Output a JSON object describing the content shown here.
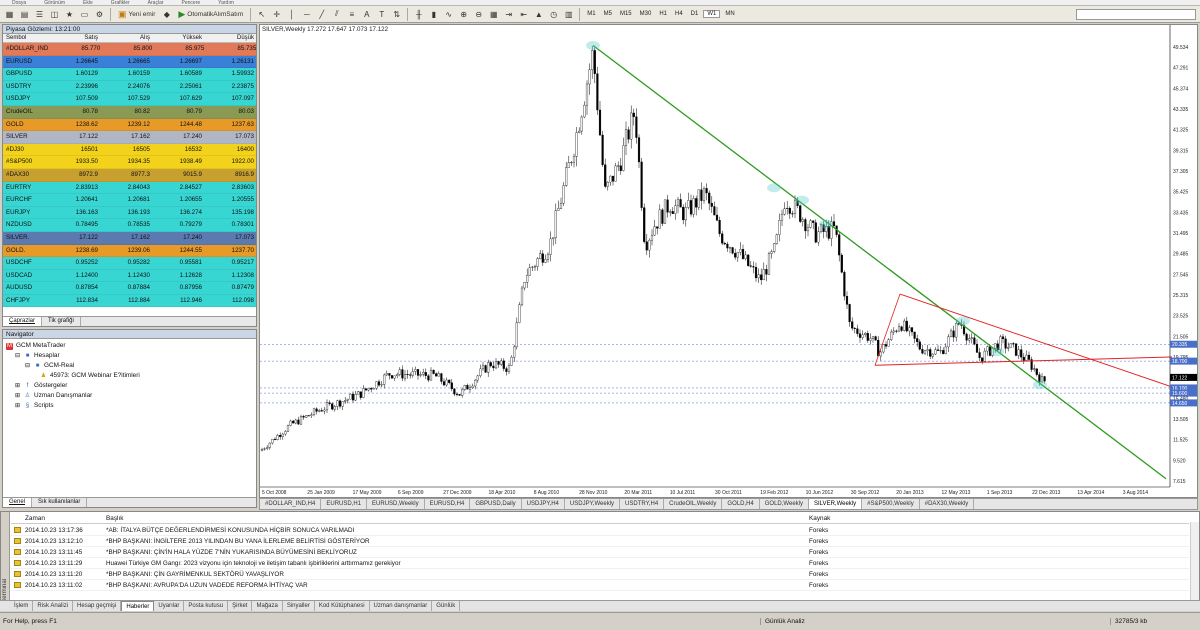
{
  "menu": [
    "Dosya",
    "Görünüm",
    "Ekle",
    "Grafikler",
    "Araçlar",
    "Pencere",
    "Yardım"
  ],
  "toolbar": {
    "new_order": "Yeni emir",
    "autotrade": "OtomatikAlımSatım",
    "timeframes": [
      "M1",
      "M5",
      "M15",
      "M30",
      "H1",
      "H4",
      "D1",
      "W1",
      "MN"
    ],
    "active_tf": "W1"
  },
  "market_watch": {
    "title": "Piyasa Gözlemi: 13:21:00",
    "headers": [
      "Sembol",
      "Satış",
      "Alış",
      "Yüksek",
      "Düşük"
    ],
    "rows": [
      {
        "sym": "#DOLLAR_IND",
        "bid": "85.770",
        "ask": "85.800",
        "high": "85.975",
        "low": "85.735",
        "bg": "#e27a5a"
      },
      {
        "sym": "EURUSD",
        "bid": "1.26645",
        "ask": "1.26665",
        "high": "1.26697",
        "low": "1.26131",
        "bg": "#3a7fd8"
      },
      {
        "sym": "GBPUSD",
        "bid": "1.60129",
        "ask": "1.60159",
        "high": "1.60589",
        "low": "1.59932",
        "bg": "#37d6d2"
      },
      {
        "sym": "USDTRY",
        "bid": "2.23996",
        "ask": "2.24076",
        "high": "2.25061",
        "low": "2.23875",
        "bg": "#37d6d2"
      },
      {
        "sym": "USDJPY",
        "bid": "107.509",
        "ask": "107.529",
        "high": "107.629",
        "low": "107.097",
        "bg": "#37d6d2"
      },
      {
        "sym": "CrudeOIL",
        "bid": "80.78",
        "ask": "80.82",
        "high": "80.79",
        "low": "80.03",
        "bg": "#8a9a55"
      },
      {
        "sym": "GOLD",
        "bid": "1238.62",
        "ask": "1239.12",
        "high": "1244.48",
        "low": "1237.63",
        "bg": "#e79a27"
      },
      {
        "sym": "SILVER",
        "bid": "17.122",
        "ask": "17.162",
        "high": "17.240",
        "low": "17.073",
        "bg": "#b0b6c4"
      },
      {
        "sym": "#DJ30",
        "bid": "16501",
        "ask": "16505",
        "high": "16532",
        "low": "16400",
        "bg": "#f2d21a"
      },
      {
        "sym": "#S&P500",
        "bid": "1933.50",
        "ask": "1934.35",
        "high": "1938.49",
        "low": "1922.00",
        "bg": "#f2d21a"
      },
      {
        "sym": "#DAX30",
        "bid": "8972.9",
        "ask": "8977.3",
        "high": "9015.9",
        "low": "8916.9",
        "bg": "#c8a030"
      },
      {
        "sym": "EURTRY",
        "bid": "2.83913",
        "ask": "2.84043",
        "high": "2.84527",
        "low": "2.83603",
        "bg": "#37d6d2"
      },
      {
        "sym": "EURCHF",
        "bid": "1.20641",
        "ask": "1.20681",
        "high": "1.20655",
        "low": "1.20555",
        "bg": "#37d6d2"
      },
      {
        "sym": "EURJPY",
        "bid": "136.163",
        "ask": "136.193",
        "high": "136.274",
        "low": "135.198",
        "bg": "#37d6d2"
      },
      {
        "sym": "NZDUSD",
        "bid": "0.78495",
        "ask": "0.78535",
        "high": "0.79279",
        "low": "0.78301",
        "bg": "#37d6d2"
      },
      {
        "sym": "SILVER.",
        "bid": "17.122",
        "ask": "17.162",
        "high": "17.240",
        "low": "17.073",
        "bg": "#5b7bb0"
      },
      {
        "sym": "GOLD.",
        "bid": "1238.69",
        "ask": "1239.06",
        "high": "1244.55",
        "low": "1237.70",
        "bg": "#e79a27"
      },
      {
        "sym": "USDCHF",
        "bid": "0.95252",
        "ask": "0.95282",
        "high": "0.95581",
        "low": "0.95217",
        "bg": "#37d6d2"
      },
      {
        "sym": "USDCAD",
        "bid": "1.12400",
        "ask": "1.12430",
        "high": "1.12628",
        "low": "1.12308",
        "bg": "#37d6d2"
      },
      {
        "sym": "AUDUSD",
        "bid": "0.87854",
        "ask": "0.87884",
        "high": "0.87956",
        "low": "0.87479",
        "bg": "#37d6d2"
      },
      {
        "sym": "CHFJPY",
        "bid": "112.834",
        "ask": "112.884",
        "high": "112.946",
        "low": "112.098",
        "bg": "#37d6d2"
      }
    ],
    "tabs": [
      "Çaprazlar",
      "Tik grafiği"
    ]
  },
  "navigator": {
    "title": "Navigator",
    "root": "GCM MetaTrader",
    "accounts": "Hesaplar",
    "server": "GCM-Real",
    "account": "45973: GCM Webinar E?itimleri",
    "indicators": "Göstergeler",
    "experts": "Uzman Danışmanlar",
    "scripts": "Scripts",
    "tabs": [
      "Genel",
      "Sık kullanılanlar"
    ]
  },
  "chart": {
    "header": "SILVER,Weekly  17.272 17.647 17.073 17.122",
    "x_labels": [
      "5 Oct 2008",
      "25 Jan 2009",
      "17 May 2009",
      "6 Sep 2009",
      "27 Dec 2009",
      "18 Apr 2010",
      "8 Aug 2010",
      "28 Nov 2010",
      "20 Mar 2011",
      "10 Jul 2011",
      "30 Oct 2011",
      "19 Feb 2012",
      "10 Jun 2012",
      "30 Sep 2012",
      "20 Jan 2013",
      "12 May 2013",
      "1 Sep 2013",
      "22 Dec 2013",
      "13 Apr 2014",
      "3 Aug 2014"
    ],
    "y_labels": [
      "49.534",
      "47.291",
      "45.374",
      "43.335",
      "41.325",
      "39.315",
      "37.305",
      "35.425",
      "33.435",
      "31.495",
      "29.485",
      "27.545",
      "25.315",
      "23.525",
      "21.505",
      "19.795",
      "17.122",
      "15.480",
      "13.505",
      "11.525",
      "9.520",
      "7.615"
    ],
    "tag_labels": [
      {
        "text": "20.335",
        "color": "#4a6fc8"
      },
      {
        "text": "18.700",
        "color": "#4a6fc8"
      },
      {
        "text": "17.122",
        "color": "#000000"
      },
      {
        "text": "16.100",
        "color": "#4a6fc8"
      },
      {
        "text": "15.600",
        "color": "#4a6fc8"
      },
      {
        "text": "14.650",
        "color": "#4a6fc8"
      }
    ],
    "tabs": [
      "#DOLLAR_IND,H4",
      "EURUSD,H1",
      "EURUSD,Weekly",
      "EURUSD,H4",
      "GBPUSD,Daily",
      "USDJPY,H4",
      "USDJPY,Weekly",
      "USDTRY,H4",
      "CrudeOIL,Weekly",
      "GOLD,H4",
      "GOLD,Weekly",
      "SILVER,Weekly",
      "#S&P500,Weekly",
      "#DAX30,Weekly"
    ],
    "active_tab": "SILVER,Weekly"
  },
  "terminal": {
    "side_label": "Terminal",
    "headers": [
      "Zaman",
      "Başlık",
      "Kaynak"
    ],
    "rows": [
      {
        "time": "2014.10.23 13:17:36",
        "title": "*AB: İTALYA BÜTÇE DEĞERLENDİRMESİ KONUSUNDA HİÇBİR SONUCA VARILMADI",
        "src": "Foreks"
      },
      {
        "time": "2014.10.23 13:12:10",
        "title": "*BHP BAŞKANI: İNGİLTERE 2013 YILINDAN BU YANA İLERLEME BELİRTİSİ GÖSTERİYOR",
        "src": "Foreks"
      },
      {
        "time": "2014.10.23 13:11:45",
        "title": "*BHP BAŞKANI: ÇİN'İN HALA YÜZDE 7'NİN YUKARISINDA BÜYÜMESİNİ BEKLİYORUZ",
        "src": "Foreks"
      },
      {
        "time": "2014.10.23 13:11:29",
        "title": "Huawei Türkiye GM Gangı: 2023 vizyonu için teknoloji ve iletişim tabanlı işbirliklerini arttırmamız gerekiyor",
        "src": "Foreks"
      },
      {
        "time": "2014.10.23 13:11:20",
        "title": "*BHP BAŞKANI: ÇİN GAYRİMENKUL SEKTÖRÜ YAVAŞLIYOR",
        "src": "Foreks"
      },
      {
        "time": "2014.10.23 13:11:02",
        "title": "*BHP BAŞKANI: AVRUPA'DA UZUN VADEDE REFORMA İHTİYAÇ VAR",
        "src": "Foreks"
      }
    ],
    "tabs": [
      "İşlem",
      "Risk Analizi",
      "Hesap geçmişi",
      "Haberler",
      "Uyarılar",
      "Posta kutusu",
      "Şirket",
      "Mağaza",
      "Sinyaller",
      "Kod Kütüphanesi",
      "Uzman danışmanlar",
      "Günlük"
    ],
    "active_tab": "Haberler"
  },
  "status": {
    "help": "For Help, press F1",
    "profile": "Günlük Analiz",
    "traffic": "32785/3 kb"
  },
  "colors": {
    "trend_green": "#2e9b1f",
    "trend_red": "#e02424",
    "candle": "#000000",
    "guide_blue": "#4a6fc8"
  }
}
